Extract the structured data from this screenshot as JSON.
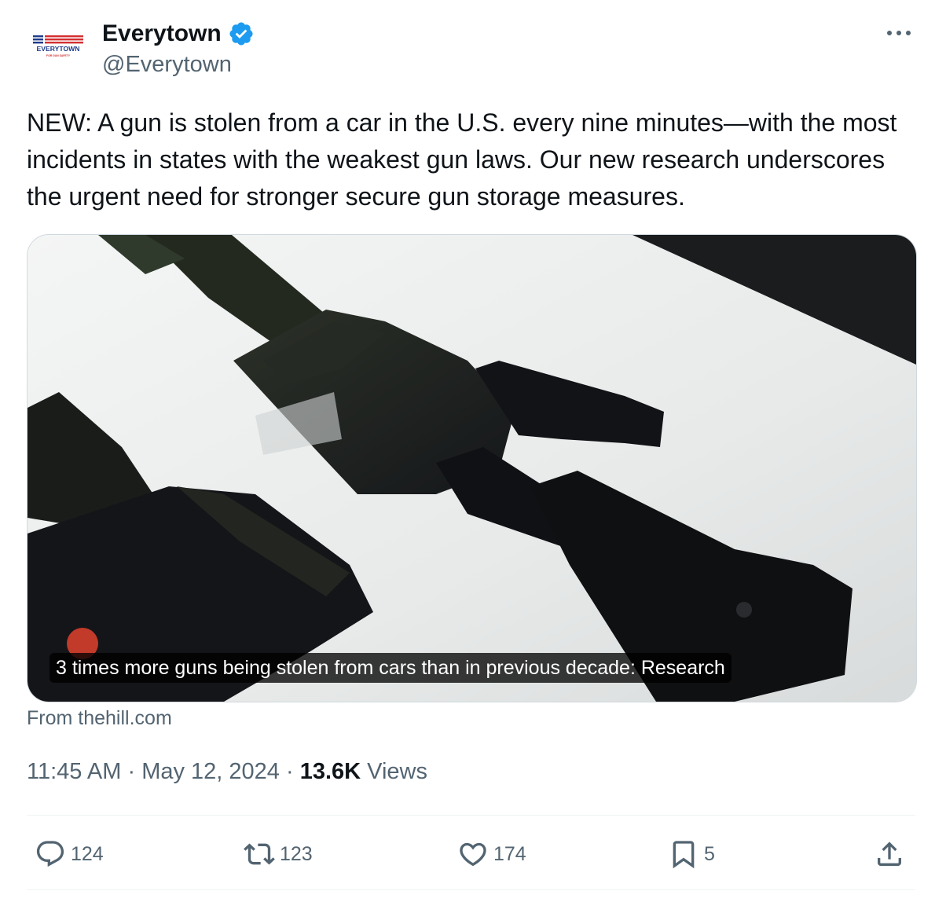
{
  "tweet": {
    "author": {
      "name": "Everytown",
      "handle": "@Everytown",
      "avatar_logo_text": "EVERYTOWN",
      "avatar_logo_subtext": "FOR GUN SAFETY",
      "verified": true
    },
    "more_icon": "more-horizontal-icon",
    "text": "NEW: A gun is stolen from a car in the U.S. every nine minutes—with the most incidents in states with the weakest gun laws. Our new research underscores the urgent need for stronger secure gun storage measures.",
    "card": {
      "caption": "3 times more guns being stolen from cars than in previous decade: Research",
      "source": "From thehill.com"
    },
    "time": "11:45 AM",
    "separator": "·",
    "date": "May 12, 2024",
    "views_count": "13.6K",
    "views_label": "Views",
    "actions": {
      "replies": "124",
      "reposts": "123",
      "likes": "174",
      "bookmarks": "5"
    }
  },
  "colors": {
    "text_primary": "#0f1419",
    "text_secondary": "#536471",
    "verified_blue": "#1d9bf0",
    "border": "#cfd9de",
    "logo_red": "#d32f2f",
    "logo_blue": "#1f3b8a"
  }
}
